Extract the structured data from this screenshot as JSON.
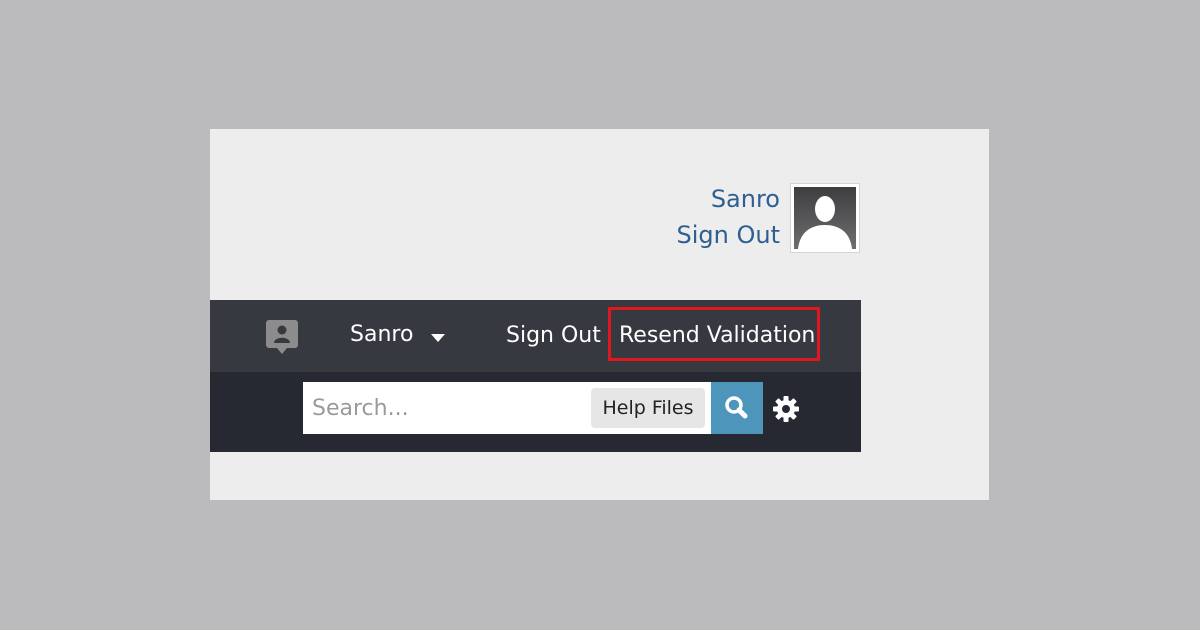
{
  "user_panel": {
    "username": "Sanro",
    "sign_out": "Sign Out"
  },
  "nav": {
    "profile_icon": "profile-badge-icon",
    "user_menu_label": "Sanro",
    "sign_out": "Sign Out",
    "resend_validation": "Resend Validation"
  },
  "search": {
    "placeholder": "Search...",
    "value": "",
    "scope_label": "Help Files",
    "search_icon": "magnifier-icon",
    "settings_icon": "gear-icon"
  },
  "colors": {
    "link": "#2e5f92",
    "topbar": "#363940",
    "searchbar": "#262932",
    "search_button": "#4d95bb",
    "highlight": "#e0171f"
  }
}
